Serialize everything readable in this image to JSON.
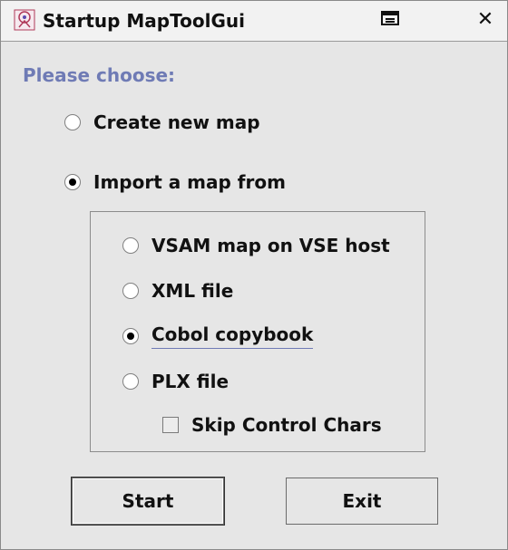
{
  "window": {
    "title": "Startup MapToolGui",
    "close_glyph": "✕"
  },
  "prompt": "Please choose:",
  "options": {
    "create_new": {
      "label": "Create new map",
      "selected": false
    },
    "import_from": {
      "label": "Import a map from",
      "selected": true
    }
  },
  "import_sources": [
    {
      "label": "VSAM map on VSE host",
      "selected": false
    },
    {
      "label": "XML file",
      "selected": false
    },
    {
      "label": "Cobol copybook",
      "selected": true
    },
    {
      "label": "PLX file",
      "selected": false
    }
  ],
  "skip_control_chars": {
    "label": "Skip Control Chars",
    "checked": false
  },
  "buttons": {
    "start": "Start",
    "exit": "Exit"
  },
  "colors": {
    "prompt": "#6f7bb5",
    "background": "#e6e6e6"
  },
  "icons": {
    "app": "maptool-app-icon",
    "restore": "restore-window-icon",
    "close": "close-icon"
  }
}
